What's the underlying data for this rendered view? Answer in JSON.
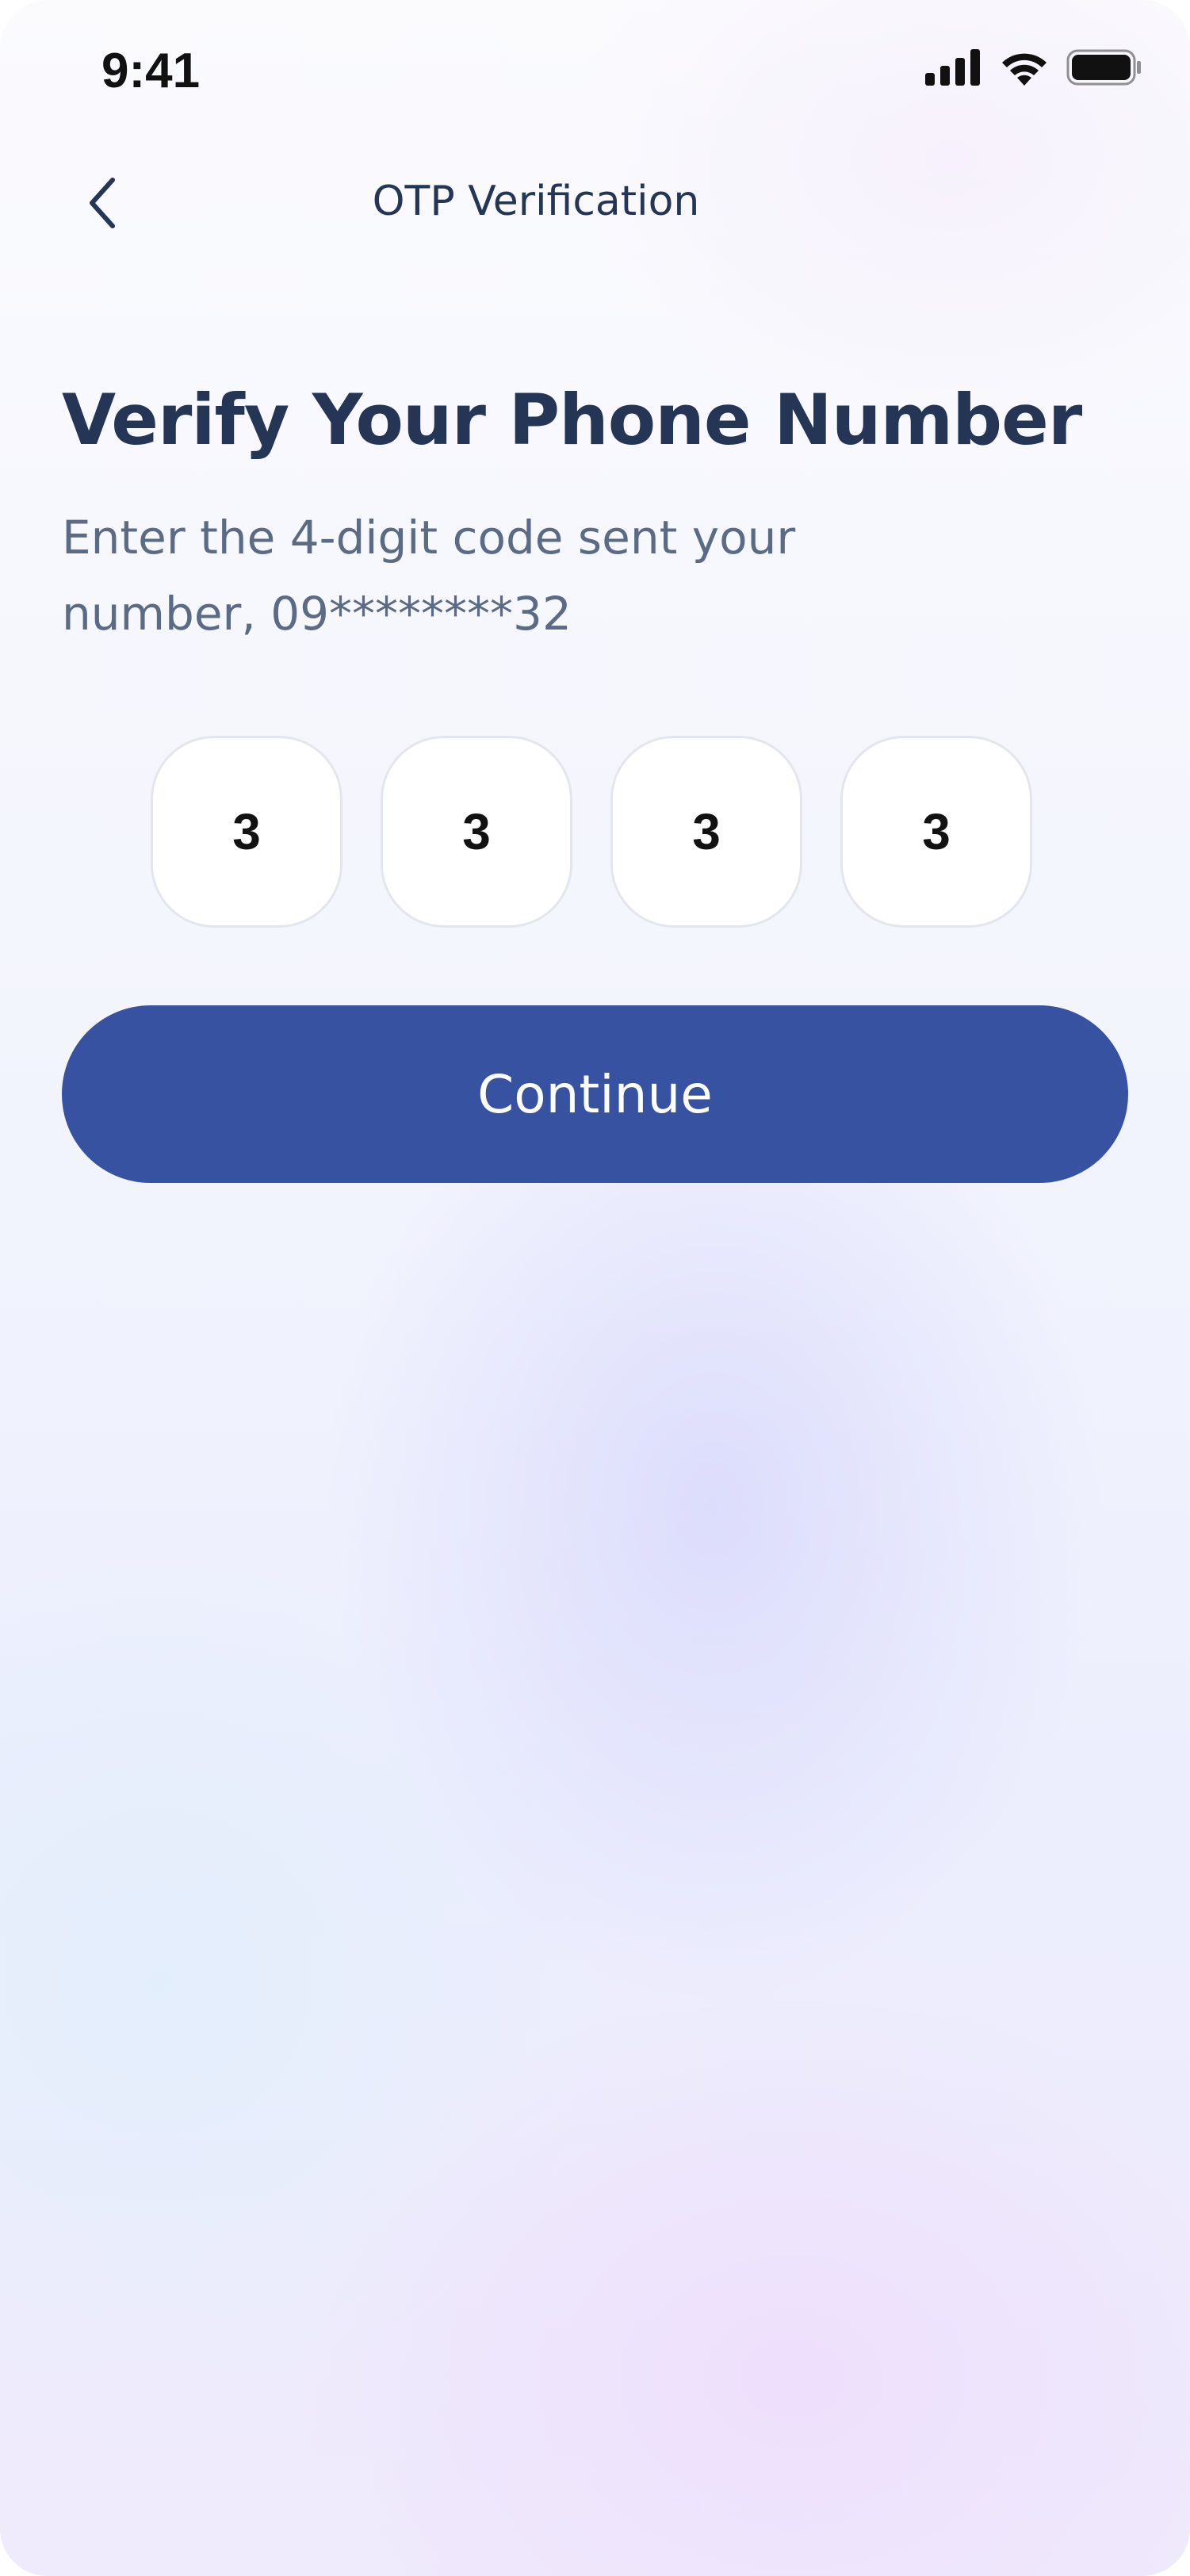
{
  "status_bar": {
    "time": "9:41",
    "icons": [
      "cellular-signal-icon",
      "wifi-icon",
      "battery-icon"
    ]
  },
  "nav": {
    "back_icon": "chevron-left-icon",
    "title": "OTP Verification"
  },
  "main": {
    "heading": "Verify Your Phone Number",
    "subtitle": "Enter the 4-digit code sent your number, 09********32",
    "otp_digits": [
      "3",
      "3",
      "3",
      "3"
    ],
    "continue_label": "Continue"
  },
  "colors": {
    "primary": "#3652A1",
    "heading_text": "#243556",
    "body_text": "#5B6B86"
  }
}
